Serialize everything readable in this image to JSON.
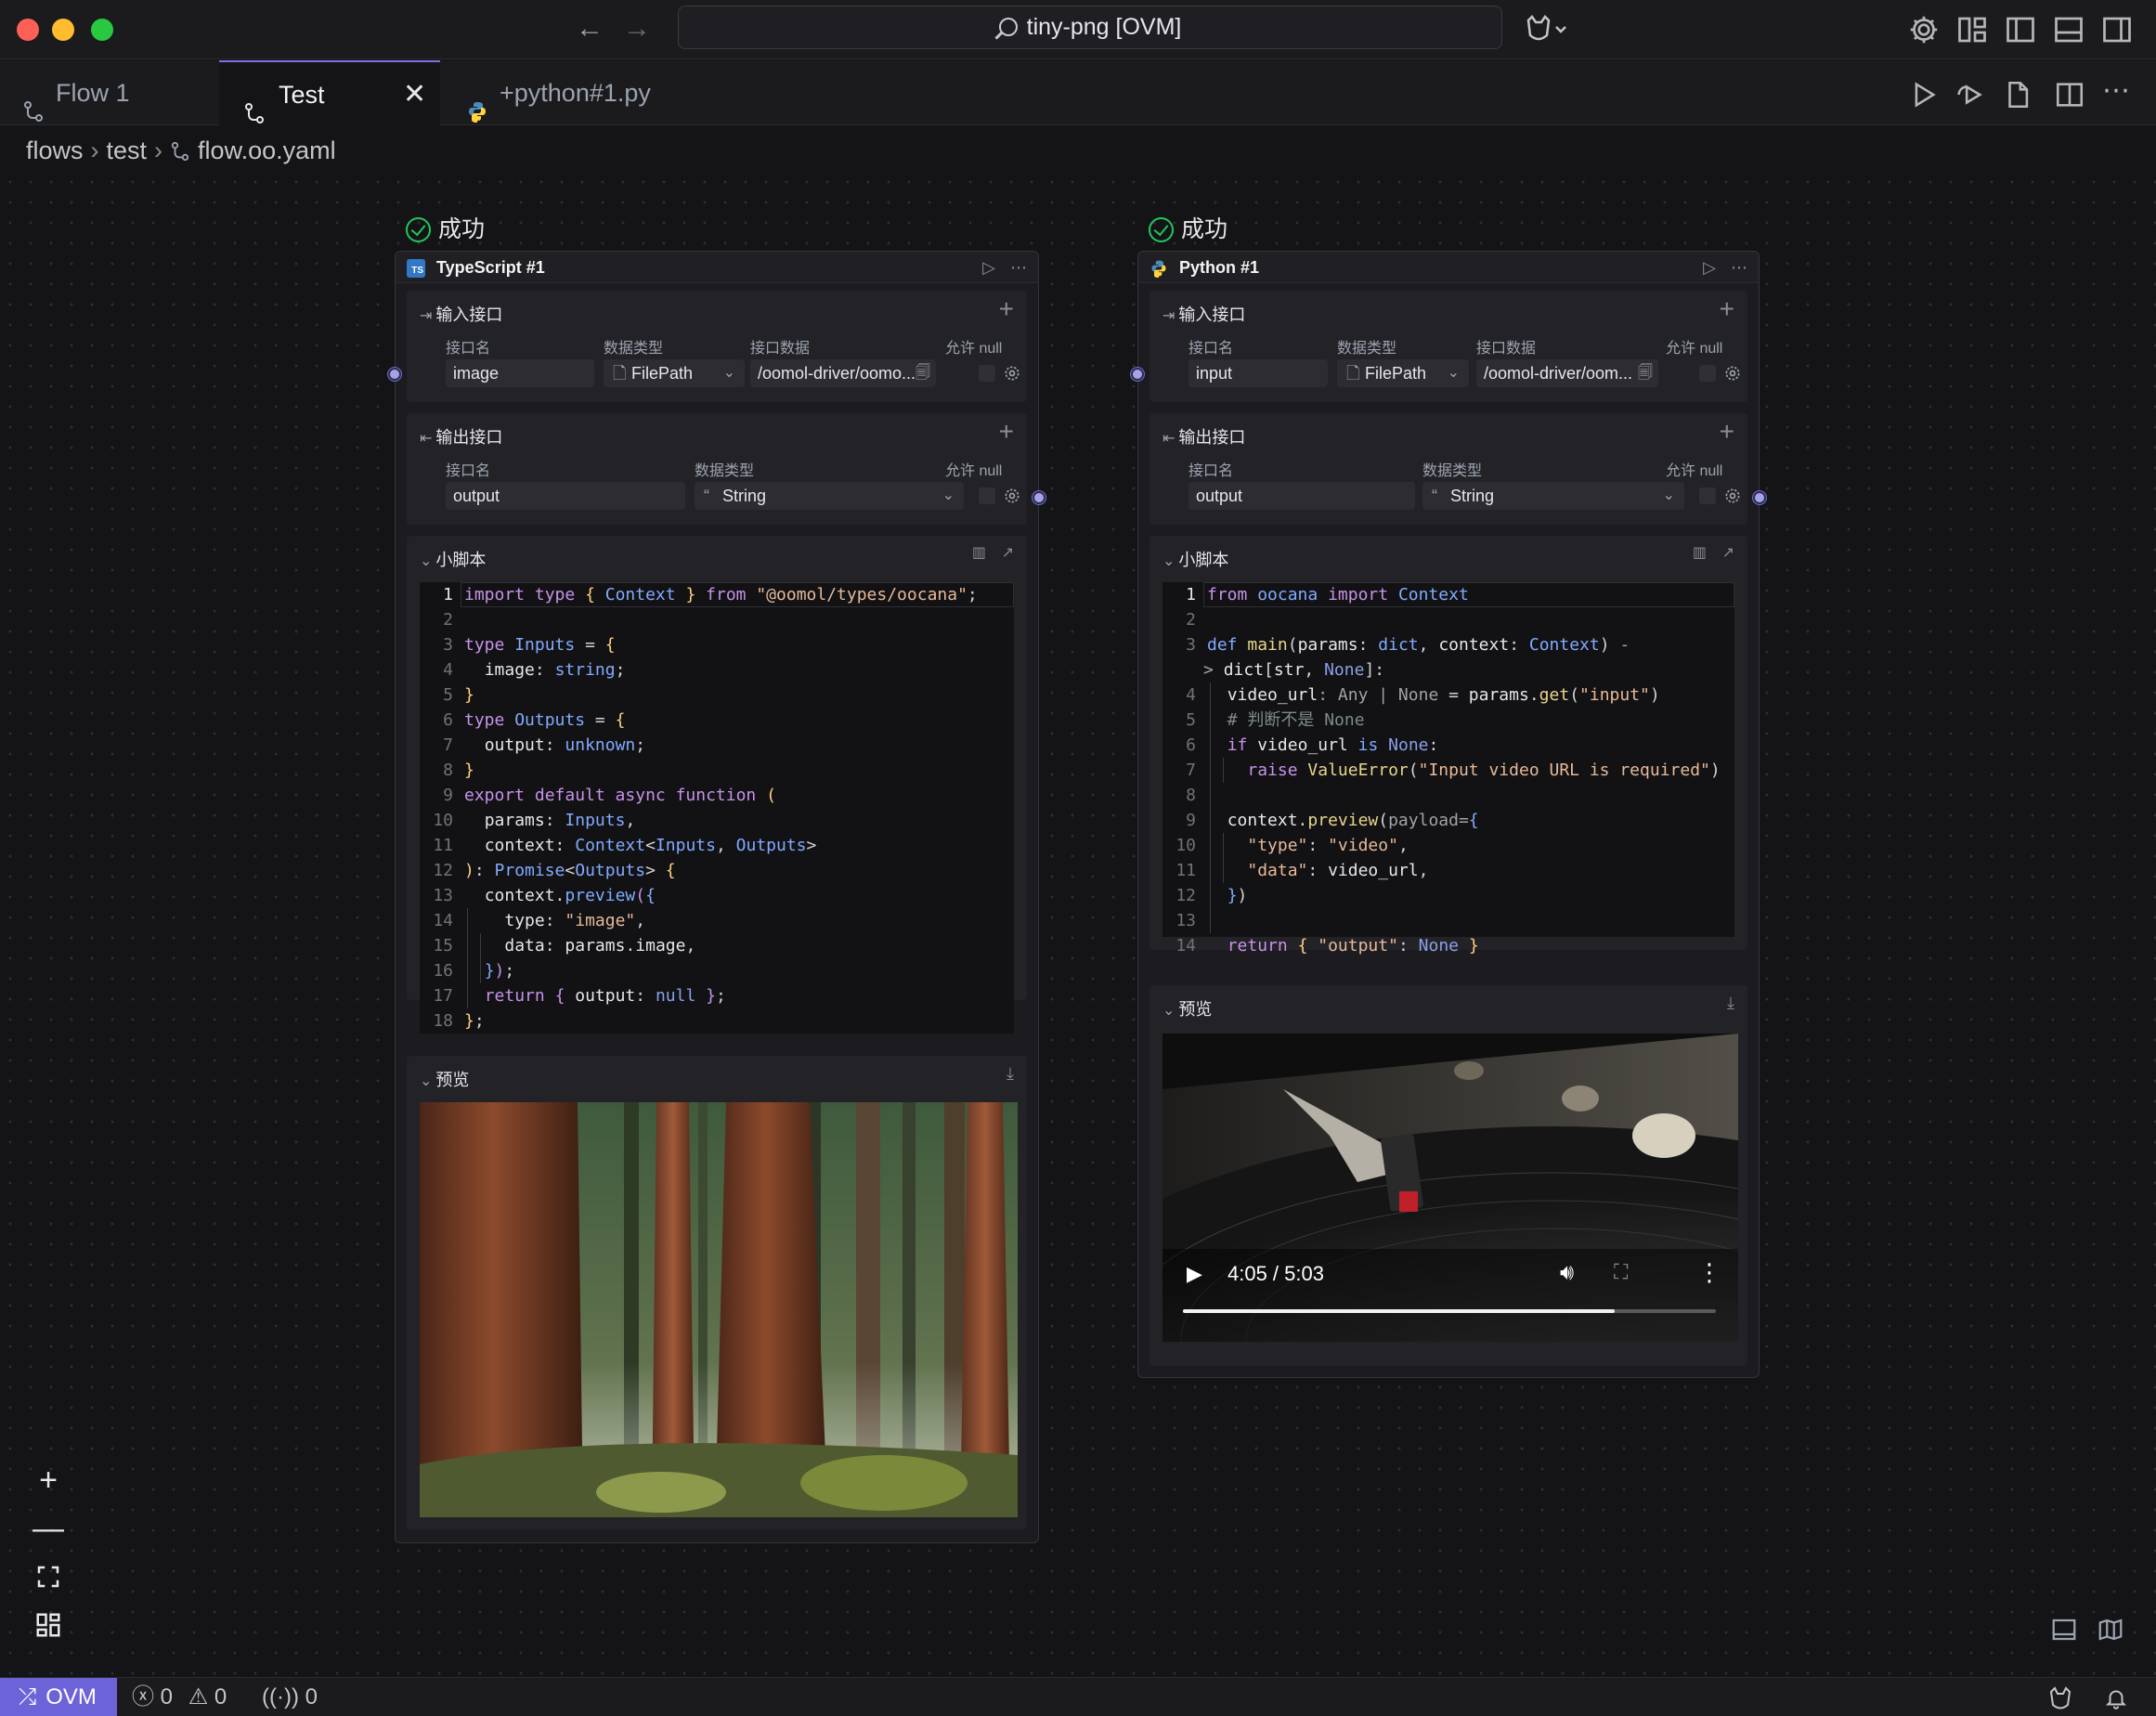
{
  "window": {
    "title": "tiny-png [OVM]",
    "traffic_colors": [
      "#fe5f57",
      "#febc2e",
      "#28c840"
    ]
  },
  "tabs": [
    {
      "label": "Flow 1",
      "active": false
    },
    {
      "label": "Test",
      "active": true
    },
    {
      "label": "+python#1.py",
      "active": false
    }
  ],
  "breadcrumb": {
    "parts": [
      "flows",
      "test",
      "flow.oo.yaml"
    ]
  },
  "ts_node": {
    "status": "成功",
    "title": "TypeScript #1",
    "badge": "TS",
    "inputs": {
      "title": "输入接口",
      "col_name": "接口名",
      "col_type": "数据类型",
      "col_data": "接口数据",
      "col_null": "允许 null",
      "name": "image",
      "type": "FilePath",
      "value": "/oomol-driver/oomo..."
    },
    "outputs": {
      "title": "输出接口",
      "col_name": "接口名",
      "col_type": "数据类型",
      "col_null": "允许 null",
      "name": "output",
      "type": "String"
    },
    "script": {
      "title": "小脚本"
    },
    "code_lines": [
      "1",
      "2",
      "3",
      "4",
      "5",
      "6",
      "7",
      "8",
      "9",
      "10",
      "11",
      "12",
      "13",
      "14",
      "15",
      "16",
      "17",
      "18"
    ],
    "preview": {
      "title": "预览"
    }
  },
  "py_node": {
    "status": "成功",
    "title": "Python #1",
    "inputs": {
      "title": "输入接口",
      "col_name": "接口名",
      "col_type": "数据类型",
      "col_data": "接口数据",
      "col_null": "允许 null",
      "name": "input",
      "type": "FilePath",
      "value": "/oomol-driver/oom..."
    },
    "outputs": {
      "title": "输出接口",
      "col_name": "接口名",
      "col_type": "数据类型",
      "col_null": "允许 null",
      "name": "output",
      "type": "String"
    },
    "script": {
      "title": "小脚本"
    },
    "preview": {
      "title": "预览",
      "video_time": "4:05 / 5:03",
      "progress": 0.81
    }
  },
  "statusbar": {
    "env": "OVM",
    "errors": "0",
    "warnings": "0",
    "ports": "0"
  }
}
